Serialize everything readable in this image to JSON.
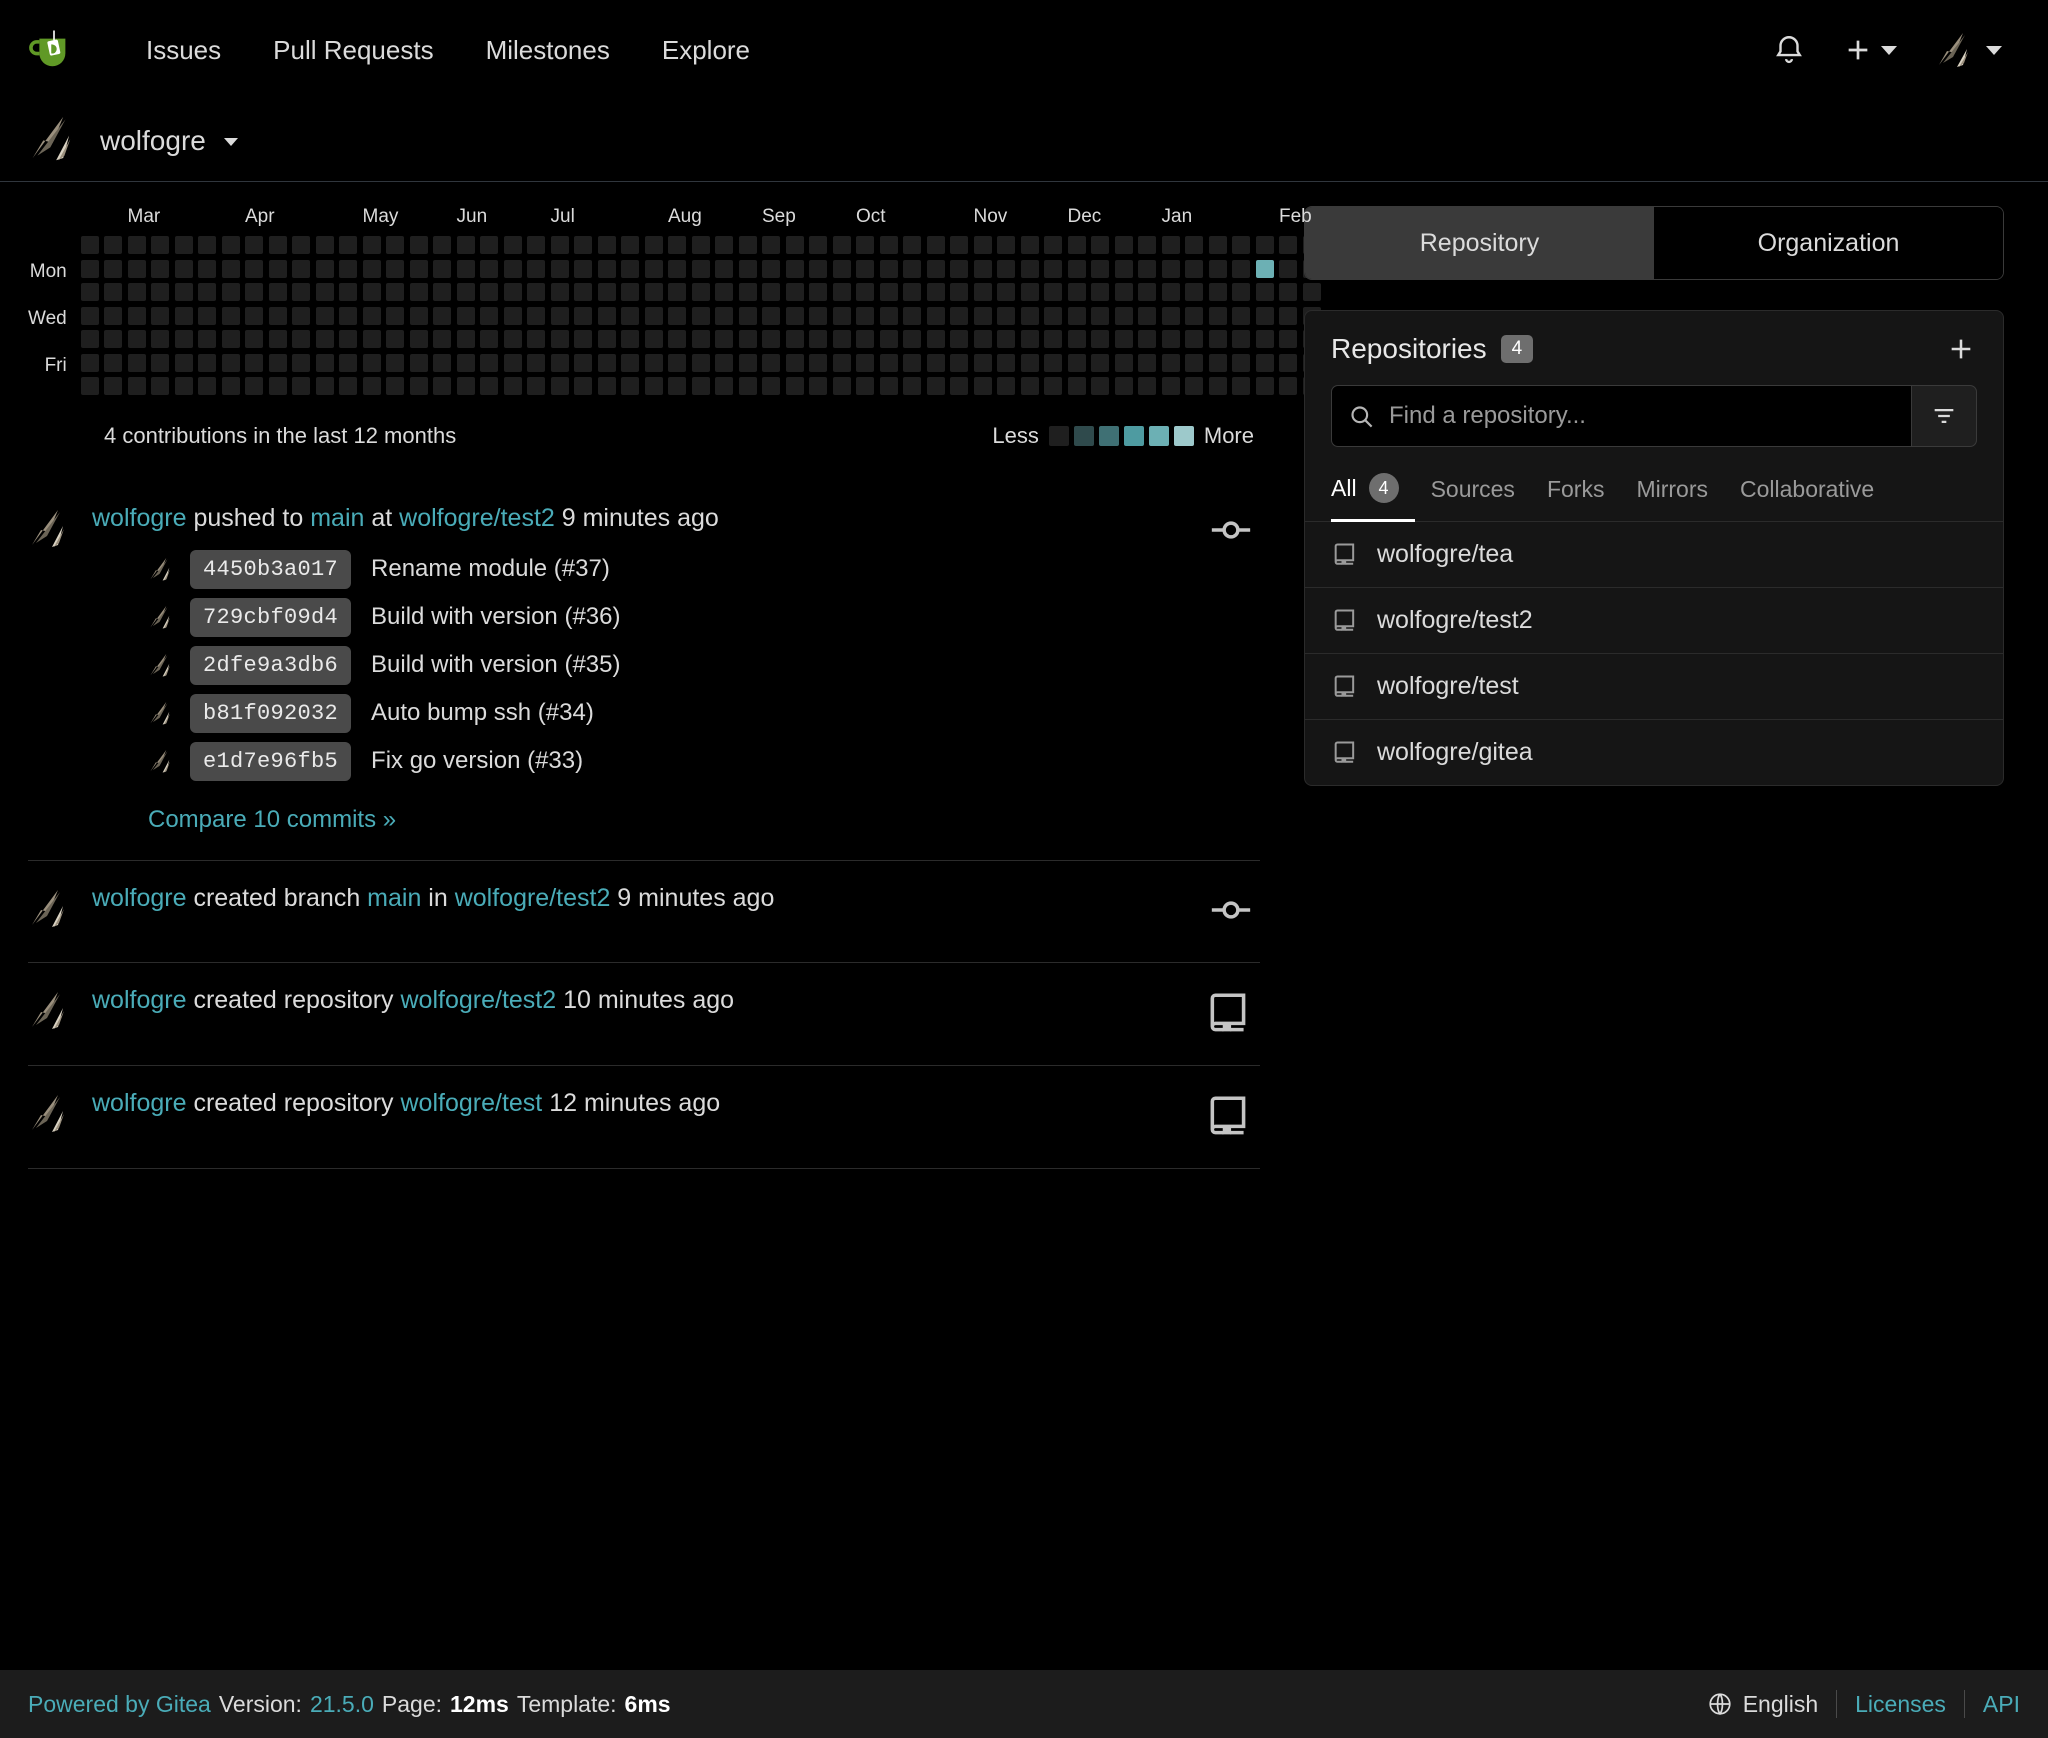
{
  "navbar": {
    "logo_icon": "gitea-teacup-logo",
    "links": [
      {
        "label": "Issues"
      },
      {
        "label": "Pull Requests"
      },
      {
        "label": "Milestones"
      },
      {
        "label": "Explore"
      }
    ],
    "notification_icon": "bell-icon",
    "create_icon": "plus-icon",
    "avatar_icon": "user-avatar"
  },
  "user_header": {
    "username": "wolfogre",
    "avatar_icon": "user-avatar"
  },
  "heatmap": {
    "months": [
      "Mar",
      "Apr",
      "May",
      "Jun",
      "Jul",
      "Aug",
      "Sep",
      "Oct",
      "Nov",
      "Dec",
      "Jan",
      "Feb"
    ],
    "days": [
      "Mon",
      "Wed",
      "Fri"
    ],
    "contributions_text": "4 contributions in the last 12 months",
    "legend_less": "Less",
    "legend_more": "More",
    "legend_colors": [
      "#1f1f1f",
      "#2f4a4c",
      "#3f7074",
      "#4e9ba1",
      "#6cb0b4",
      "#9dc9cb"
    ],
    "active_cell": {
      "column": 50,
      "row": 1,
      "level": 4
    },
    "total_columns": 53,
    "rows": 7
  },
  "feed": [
    {
      "type": "push",
      "actor": "wolfogre",
      "action_before": " pushed to ",
      "branch": "main",
      "action_middle": " at ",
      "repo": "wolfogre/test2",
      "time": " 9 minutes ago",
      "icon": "git-commit-icon",
      "commits": [
        {
          "sha": "4450b3a017",
          "message": "Rename module (#37)"
        },
        {
          "sha": "729cbf09d4",
          "message": "Build with version (#36)"
        },
        {
          "sha": "2dfe9a3db6",
          "message": "Build with version (#35)"
        },
        {
          "sha": "b81f092032",
          "message": "Auto bump ssh (#34)"
        },
        {
          "sha": "e1d7e96fb5",
          "message": "Fix go version (#33)"
        }
      ],
      "compare_label": "Compare 10 commits »"
    },
    {
      "type": "branch",
      "actor": "wolfogre",
      "action_before": " created branch ",
      "branch": "main",
      "action_middle": " in ",
      "repo": "wolfogre/test2",
      "time": " 9 minutes ago",
      "icon": "git-commit-icon"
    },
    {
      "type": "repo",
      "actor": "wolfogre",
      "action_before": " created repository ",
      "repo": "wolfogre/test2",
      "time": " 10 minutes ago",
      "icon": "repo-icon"
    },
    {
      "type": "repo",
      "actor": "wolfogre",
      "action_before": " created repository ",
      "repo": "wolfogre/test",
      "time": " 12 minutes ago",
      "icon": "repo-icon"
    }
  ],
  "sidebar": {
    "segment_tabs": [
      {
        "label": "Repository",
        "active": true
      },
      {
        "label": "Organization",
        "active": false
      }
    ],
    "panel_title": "Repositories",
    "panel_count": "4",
    "add_icon": "plus-icon",
    "search": {
      "placeholder": "Find a repository...",
      "value": "",
      "icon": "search-icon",
      "filter_icon": "filter-icon"
    },
    "filter_tabs": [
      {
        "label": "All",
        "count": "4",
        "active": true
      },
      {
        "label": "Sources",
        "active": false
      },
      {
        "label": "Forks",
        "active": false
      },
      {
        "label": "Mirrors",
        "active": false
      },
      {
        "label": "Collaborative",
        "active": false
      }
    ],
    "repositories": [
      {
        "name": "wolfogre/tea",
        "icon": "repo-icon"
      },
      {
        "name": "wolfogre/test2",
        "icon": "repo-icon"
      },
      {
        "name": "wolfogre/test",
        "icon": "repo-icon"
      },
      {
        "name": "wolfogre/gitea",
        "icon": "repo-icon"
      }
    ]
  },
  "footer": {
    "powered_by": "Powered by Gitea",
    "version_label": "Version:",
    "version_value": "21.5.0",
    "page_label": "Page:",
    "page_value": "12ms",
    "template_label": "Template:",
    "template_value": "6ms",
    "language": "English",
    "language_icon": "globe-icon",
    "licenses": "Licenses",
    "api": "API"
  },
  "colors": {
    "accent_teal": "#4aacb8",
    "bg": "#000000",
    "panel_bg": "#151515",
    "footer_bg": "#1c1c1c",
    "heat_active": "#6cb0b4"
  }
}
